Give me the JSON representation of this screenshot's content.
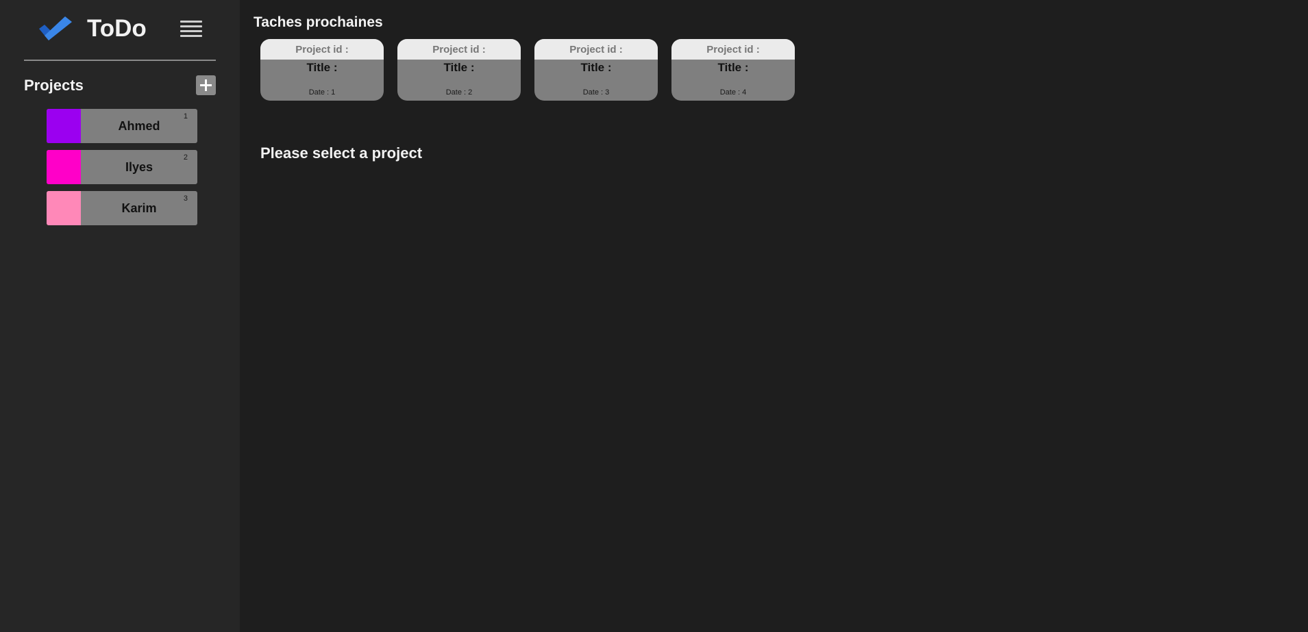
{
  "app": {
    "title": "ToDo",
    "accent_color": "#2f7be0",
    "menu_icon": "hamburger-menu-icon",
    "logo_icon": "checkmark-logo-icon"
  },
  "sidebar": {
    "projects_heading": "Projects",
    "add_icon": "plus-icon",
    "projects": [
      {
        "name": "Ahmed",
        "count": "1",
        "color": "#9b00f0"
      },
      {
        "name": "Ilyes",
        "count": "2",
        "color": "#ff00c8"
      },
      {
        "name": "Karim",
        "count": "3",
        "color": "#ff88b8"
      }
    ]
  },
  "main": {
    "section_title": "Taches prochaines",
    "tasks": [
      {
        "project_label": "Project id :",
        "title_label": "Title :",
        "date_label": "Date : 1"
      },
      {
        "project_label": "Project id :",
        "title_label": "Title :",
        "date_label": "Date : 2"
      },
      {
        "project_label": "Project id :",
        "title_label": "Title :",
        "date_label": "Date : 3"
      },
      {
        "project_label": "Project id :",
        "title_label": "Title :",
        "date_label": "Date : 4"
      }
    ],
    "empty_message": "Please select a project"
  }
}
